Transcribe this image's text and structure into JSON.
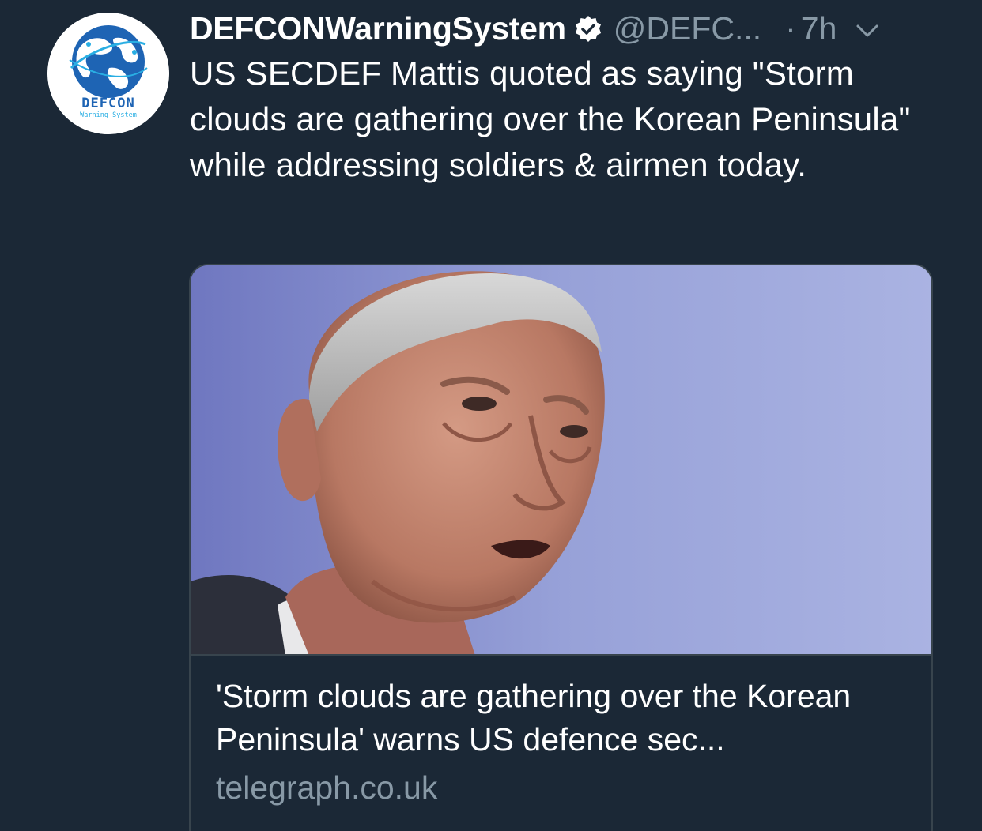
{
  "tweet": {
    "author": {
      "display_name": "DEFCONWarningSystem",
      "handle": "@DEFC...",
      "verified": true,
      "avatar": {
        "logo_text": "DEFCON",
        "logo_subtext": "Warning System",
        "icon": "globe-icon"
      }
    },
    "separator": "·",
    "time": "7h",
    "menu_icon": "chevron-down-icon",
    "text": "US SECDEF Mattis quoted as saying \"Storm clouds are gathering over the Korean Peninsula\" while addressing soldiers & airmen today.",
    "card": {
      "image_description_icon": "photo-icon",
      "title": "'Storm clouds are gathering over the Korean Peninsula' warns US defence sec...",
      "domain": "telegraph.co.uk"
    }
  },
  "colors": {
    "background": "#1b2836",
    "text_primary": "#ffffff",
    "text_secondary": "#8899a6",
    "border": "#38444d",
    "logo_blue": "#1e64b4",
    "logo_cyan": "#29aee3"
  }
}
